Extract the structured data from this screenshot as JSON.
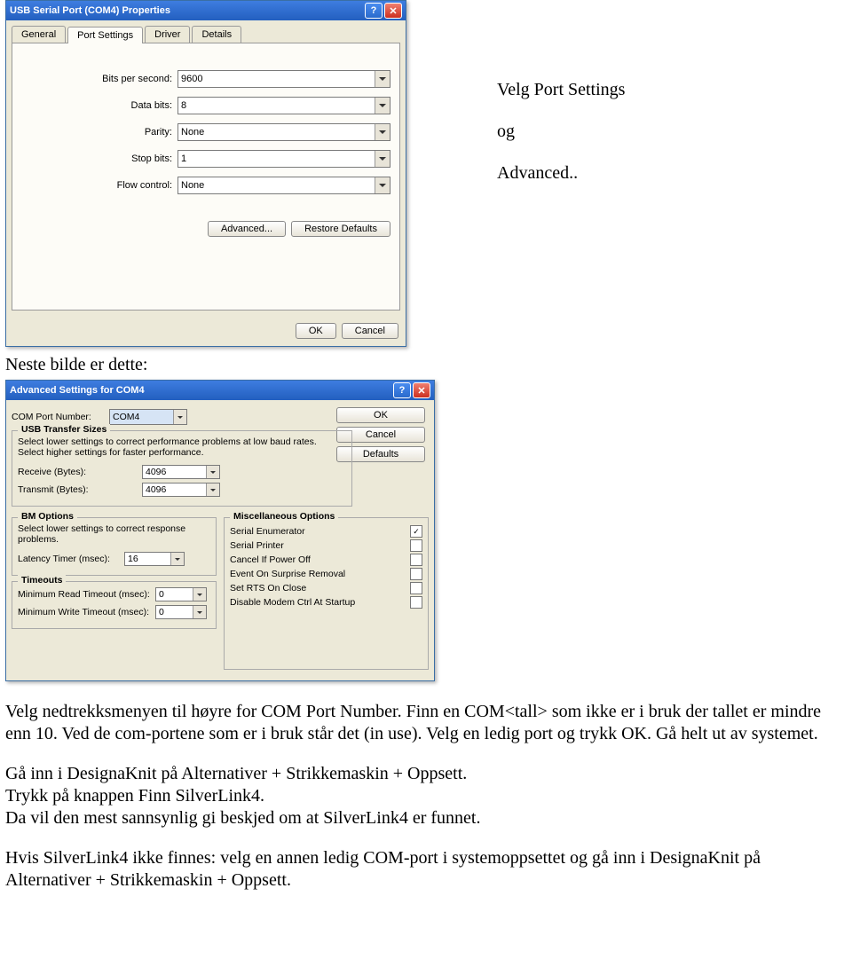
{
  "dialog1": {
    "title": "USB Serial Port (COM4) Properties",
    "tabs": [
      "General",
      "Port Settings",
      "Driver",
      "Details"
    ],
    "fields": {
      "bps_label": "Bits per second:",
      "bps_value": "9600",
      "databits_label": "Data bits:",
      "databits_value": "8",
      "parity_label": "Parity:",
      "parity_value": "None",
      "stopbits_label": "Stop bits:",
      "stopbits_value": "1",
      "flow_label": "Flow control:",
      "flow_value": "None"
    },
    "advanced_btn": "Advanced...",
    "restore_btn": "Restore Defaults",
    "ok_btn": "OK",
    "cancel_btn": "Cancel"
  },
  "sidetext": {
    "line1": "Velg Port Settings",
    "line2": "og",
    "line3": "Advanced.."
  },
  "between_text": "Neste bilde er dette:",
  "dialog2": {
    "title": "Advanced Settings for COM4",
    "comport_label": "COM Port Number:",
    "comport_value": "COM4",
    "ok_btn": "OK",
    "cancel_btn": "Cancel",
    "defaults_btn": "Defaults",
    "usb_group_title": "USB Transfer Sizes",
    "usb_note1": "Select lower settings to correct performance problems at low baud rates.",
    "usb_note2": "Select higher settings for faster performance.",
    "receive_label": "Receive (Bytes):",
    "receive_value": "4096",
    "transmit_label": "Transmit (Bytes):",
    "transmit_value": "4096",
    "bm_group_title": "BM Options",
    "bm_note": "Select lower settings to correct response problems.",
    "latency_label": "Latency Timer (msec):",
    "latency_value": "16",
    "timeouts_title": "Timeouts",
    "min_read_label": "Minimum Read Timeout (msec):",
    "min_read_value": "0",
    "min_write_label": "Minimum Write Timeout (msec):",
    "min_write_value": "0",
    "misc_title": "Miscellaneous Options",
    "misc": [
      {
        "label": "Serial Enumerator",
        "checked": true
      },
      {
        "label": "Serial Printer",
        "checked": false
      },
      {
        "label": "Cancel If Power Off",
        "checked": false
      },
      {
        "label": "Event On Surprise Removal",
        "checked": false
      },
      {
        "label": "Set RTS On Close",
        "checked": false
      },
      {
        "label": "Disable Modem Ctrl At Startup",
        "checked": false
      }
    ]
  },
  "doc": {
    "p1": "Velg nedtrekksmenyen til høyre for COM Port Number. Finn en COM<tall> som ikke er i bruk der tallet er mindre enn 10. Ved de com-portene som er i bruk står det (in use). Velg en ledig port og trykk OK. Gå helt ut av systemet.",
    "p2": "Gå inn i DesignaKnit på Alternativer + Strikkemaskin + Oppsett.",
    "p3": "Trykk på knappen Finn SilverLink4.",
    "p4": "Da vil den mest sannsynlig gi beskjed om at SilverLink4 er funnet.",
    "p5": "Hvis SilverLink4 ikke finnes:  velg en annen ledig COM-port i systemoppsettet og gå inn i DesignaKnit på Alternativer + Strikkemaskin + Oppsett."
  }
}
